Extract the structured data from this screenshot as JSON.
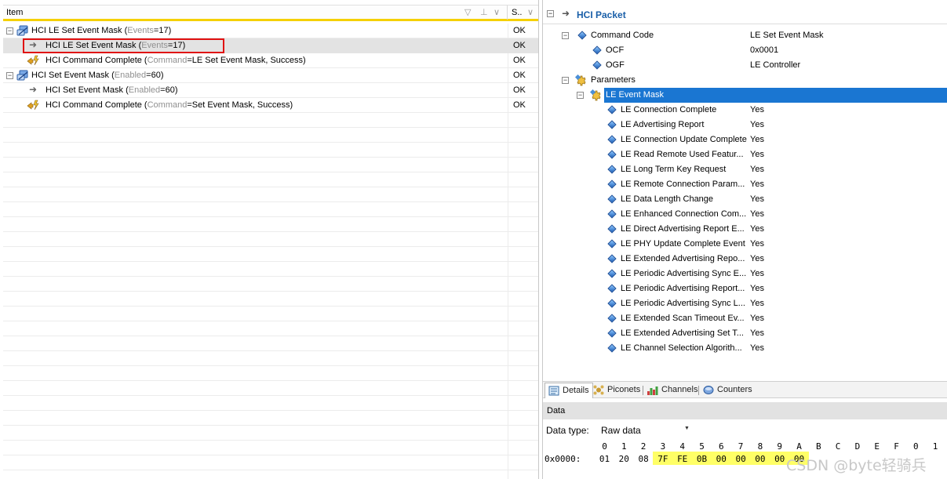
{
  "left": {
    "columns": {
      "item": "Item",
      "status": "S.."
    },
    "rows": [
      {
        "label": "HCI LE Set Event Mask",
        "open": " (",
        "param_name": "Events",
        "eq": "=17)",
        "status": "OK",
        "kind": "group",
        "expander": "⊟"
      },
      {
        "label": "HCI LE Set Event Mask",
        "open": " (",
        "param_name": "Events",
        "eq": "=17)",
        "status": "OK",
        "kind": "command"
      },
      {
        "label": "HCI Command Complete",
        "open": " (",
        "param_name": "Command",
        "eq": "=LE Set Event Mask, Success)",
        "status": "OK",
        "kind": "event"
      },
      {
        "label": "HCI Set Event Mask",
        "open": " (",
        "param_name": "Enabled",
        "eq": "=60)",
        "status": "OK",
        "kind": "group",
        "expander": "⊟"
      },
      {
        "label": "HCI Set Event Mask",
        "open": " (",
        "param_name": "Enabled",
        "eq": "=60)",
        "status": "OK",
        "kind": "command"
      },
      {
        "label": "HCI Command Complete",
        "open": " (",
        "param_name": "Command",
        "eq": "=Set Event Mask, Success)",
        "status": "OK",
        "kind": "event"
      }
    ]
  },
  "right": {
    "packet_title": "HCI Packet",
    "command_code": {
      "label": "Command Code",
      "value": "LE Set Event Mask"
    },
    "ocf": {
      "label": "OCF",
      "value": "0x0001"
    },
    "ogf": {
      "label": "OGF",
      "value": "LE Controller"
    },
    "parameters": {
      "label": "Parameters"
    },
    "event_mask": {
      "label": "LE Event Mask"
    },
    "mask_items": [
      {
        "label": "LE Connection Complete",
        "value": "Yes"
      },
      {
        "label": "LE Advertising Report",
        "value": "Yes"
      },
      {
        "label": "LE Connection Update Complete",
        "value": "Yes"
      },
      {
        "label": "LE Read Remote Used Featur...",
        "value": "Yes"
      },
      {
        "label": "LE Long Term Key Request",
        "value": "Yes"
      },
      {
        "label": "LE Remote Connection Param...",
        "value": "Yes"
      },
      {
        "label": "LE Data Length Change",
        "value": "Yes"
      },
      {
        "label": "LE Enhanced Connection Com...",
        "value": "Yes"
      },
      {
        "label": "LE Direct Advertising Report E...",
        "value": "Yes"
      },
      {
        "label": "LE PHY Update Complete Event",
        "value": "Yes"
      },
      {
        "label": "LE Extended Advertising Repo...",
        "value": "Yes"
      },
      {
        "label": "LE Periodic Advertising Sync E...",
        "value": "Yes"
      },
      {
        "label": "LE Periodic Advertising Report...",
        "value": "Yes"
      },
      {
        "label": "LE Periodic Advertising Sync L...",
        "value": "Yes"
      },
      {
        "label": "LE Extended Scan Timeout Ev...",
        "value": "Yes"
      },
      {
        "label": "LE Extended Advertising Set T...",
        "value": "Yes"
      },
      {
        "label": "LE Channel Selection Algorith...",
        "value": "Yes"
      }
    ],
    "tabs": [
      "Details",
      "Piconets",
      "Channels",
      "Counters"
    ],
    "data": {
      "title": "Data",
      "type_label": "Data type:",
      "type_value": "Raw data",
      "columns": [
        "0",
        "1",
        "2",
        "3",
        "4",
        "5",
        "6",
        "7",
        "8",
        "9",
        "A",
        "B",
        "C",
        "D",
        "E",
        "F",
        "0",
        "1"
      ],
      "offset": "0x0000:",
      "bytes": [
        "01",
        "20",
        "08",
        "7F",
        "FE",
        "0B",
        "00",
        "00",
        "00",
        "00",
        "00"
      ],
      "highlight_from": 3
    },
    "watermark": "CSDN @byte轻骑兵"
  },
  "colors": {
    "selection": "#1a76d2",
    "header_accent": "#f5d000",
    "highlight_box": "#e01010",
    "hex_highlight": "#ffff66"
  }
}
